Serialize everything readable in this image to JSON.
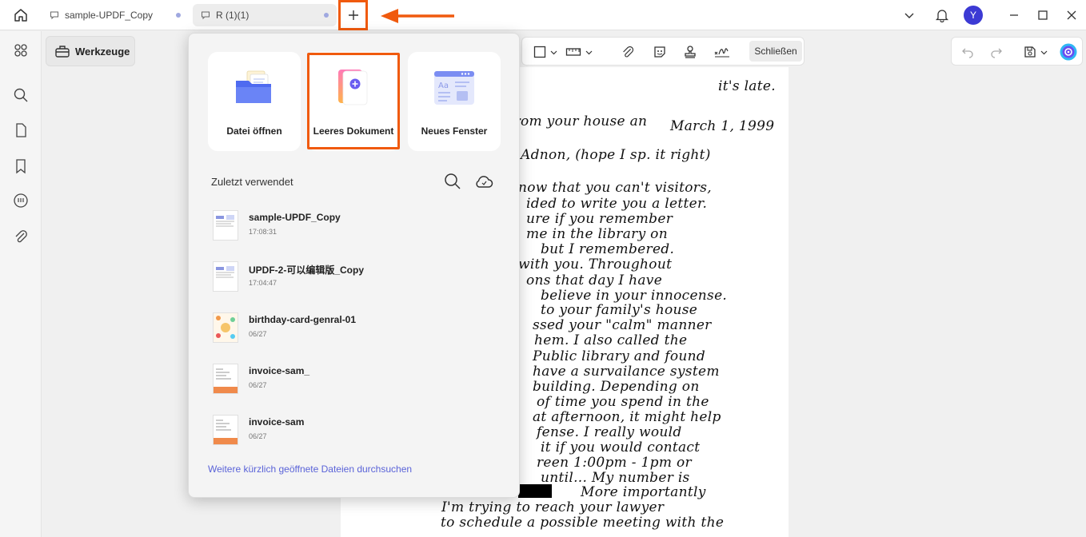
{
  "tabs": [
    {
      "label": "sample-UPDF_Copy"
    },
    {
      "label": "R (1)(1)"
    }
  ],
  "user": {
    "avatar_initial": "Y"
  },
  "toolbar": {
    "tools_label": "Werkzeuge",
    "close_label": "Schließen"
  },
  "popup": {
    "cards": [
      {
        "label": "Datei öffnen"
      },
      {
        "label": "Leeres Dokument"
      },
      {
        "label": "Neues Fenster"
      }
    ],
    "recent_heading": "Zuletzt verwendet",
    "recent_files": [
      {
        "name": "sample-UPDF_Copy",
        "time": "17:08:31"
      },
      {
        "name": "UPDF-2-可以编辑版_Copy",
        "time": "17:04:47"
      },
      {
        "name": "birthday-card-genral-01",
        "time": "06/27"
      },
      {
        "name": "invoice-sam_",
        "time": "06/27"
      },
      {
        "name": "invoice-sam",
        "time": "06/27"
      }
    ],
    "more_link": "Weitere kürzlich geöffnete Dateien durchsuchen"
  },
  "document": {
    "lines": [
      "it's late.",
      "from your house an",
      "March 1, 1999",
      "Adnon, (hope I sp. it right)",
      "now that you can't visitors,",
      "ided to write you a letter.",
      "ure if you remember",
      "me in the library on",
      "but I remembered.",
      "with you. Throughout",
      "ons that day I have",
      "believe in your innocense.",
      "to your family's house",
      "ssed your \"calm\" manner",
      "hem. I also called the",
      "Public library and found",
      "have a survailance system",
      "building. Depending on",
      "of time you spend in the",
      "at afternoon, it might help",
      "fense. I really would",
      "it if you would contact",
      "reen 1:00pm - 1pm or",
      "until... My number is",
      "More importantly",
      "I'm trying to reach your lawyer",
      "to schedule a possible meeting with the"
    ]
  },
  "colors": {
    "highlight": "#f05a0e",
    "accent": "#5a63d8",
    "avatar": "#3c3ad4"
  }
}
